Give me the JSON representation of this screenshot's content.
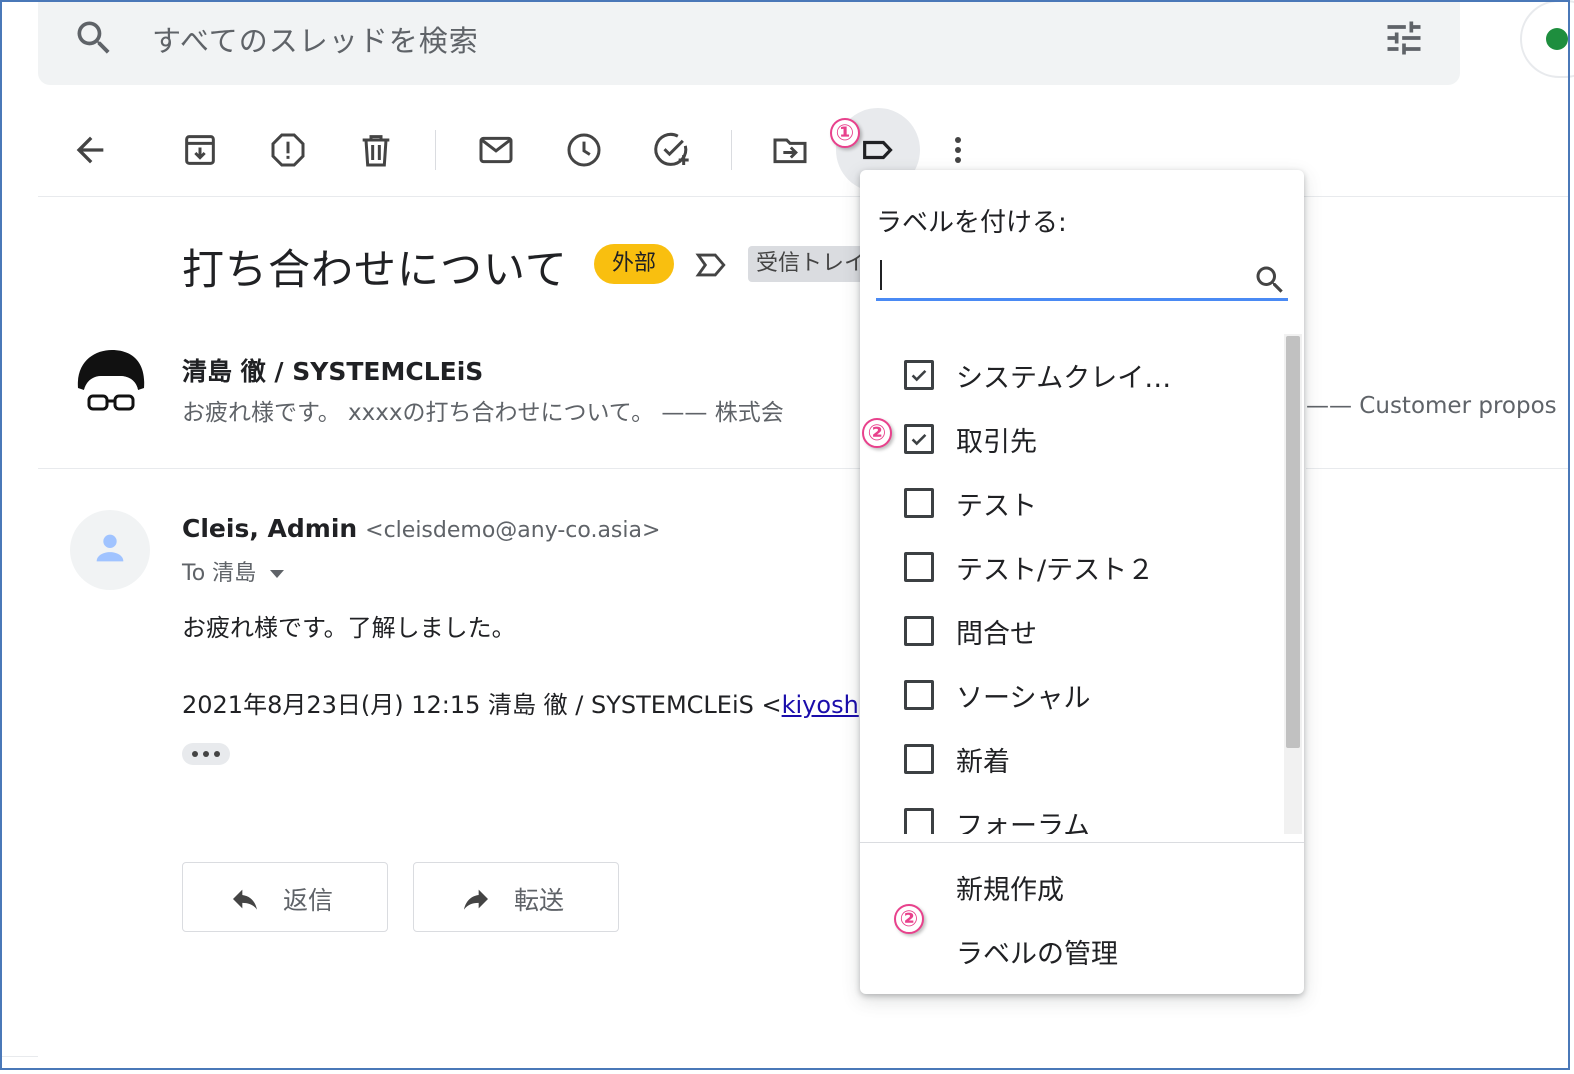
{
  "search": {
    "placeholder": "すべてのスレッドを検索"
  },
  "email": {
    "subject": "打ち合わせについて",
    "badge_external": "外部",
    "badge_inbox": "受信トレイ"
  },
  "messages": [
    {
      "sender": "清島 徹 / SYSTEMCLEiS",
      "snippet": "お疲れ様です。 xxxxの打ち合わせについて。 —— 株式会",
      "snippet_right": "—— Customer propos"
    },
    {
      "sender_name": "Cleis, Admin",
      "sender_email": "<cleisdemo@any-co.asia>",
      "to": "To 清島",
      "body": "お疲れ様です。了解しました。",
      "quote_prefix": "2021年8月23日(月) 12:15 清島 徹 / SYSTEMCLEiS <",
      "quote_link": "kiyosh"
    }
  ],
  "buttons": {
    "reply": "返信",
    "forward": "転送"
  },
  "label_menu": {
    "title": "ラベルを付ける:",
    "labels": [
      {
        "name": "システムクレイ…",
        "checked": true
      },
      {
        "name": "取引先",
        "checked": true
      },
      {
        "name": "テスト",
        "checked": false
      },
      {
        "name": "テスト/テスト２",
        "checked": false
      },
      {
        "name": "問合せ",
        "checked": false
      },
      {
        "name": "ソーシャル",
        "checked": false
      },
      {
        "name": "新着",
        "checked": false
      },
      {
        "name": "フォーラム",
        "checked": false
      }
    ],
    "create_new": "新規作成",
    "manage_labels": "ラベルの管理"
  },
  "annotations": {
    "one": "①",
    "two": "②"
  },
  "colors": {
    "accent_blue": "#4a8af4",
    "badge_yellow": "#f9bf0f",
    "annotation_pink": "#e8418c",
    "frame_blue": "#4a78b8"
  }
}
